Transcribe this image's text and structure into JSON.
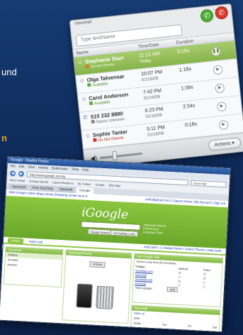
{
  "slide": {
    "fragment_1": "und",
    "fragment_2": "n",
    "fragment_3": "n,"
  },
  "callwin": {
    "title": "Voicehall",
    "search_placeholder": "Type text/Name",
    "columns": {
      "name": "Name",
      "time": "Time/Date",
      "duration": "Duration"
    },
    "rows": [
      {
        "name": "Stephanie Starr",
        "status": "On the Phone",
        "time": "11:21 AM",
        "date": "Today",
        "duration": "0:16s",
        "status_type": "phone"
      },
      {
        "name": "Olga Talvensar",
        "status": "Available",
        "time": "10:07 PM",
        "date": "01/16/08",
        "duration": "1:18s",
        "status_type": "available"
      },
      {
        "name": "Carol Anderson",
        "status": "Available",
        "time": "7:42 PM",
        "date": "01/16/08",
        "duration": "1:39s",
        "status_type": "available"
      },
      {
        "name": "510 232 8880",
        "status": "Status Unknown",
        "time": "6:23 PM",
        "date": "01/16/08",
        "duration": "2:34s",
        "status_type": "unknown"
      },
      {
        "name": "Sophie Tanter",
        "status": "Do Not Disturb",
        "time": "5:11 PM",
        "date": "01/16/08",
        "duration": "0:18s",
        "status_type": "dnd"
      }
    ],
    "actions_label": "Actions ▾"
  },
  "browser": {
    "window_title": "iGoogle - Mozilla Firefox",
    "menu": [
      "File",
      "Edit",
      "View",
      "History",
      "Bookmarks",
      "Tools",
      "Help"
    ],
    "url": "http://www.google.com/ig",
    "search_placeholder": "VoiceHall",
    "bookmarks": [
      "Most Visited",
      "Getting Started",
      "Latest Headlines",
      "My Yahoo!",
      "Google",
      "Web Mail"
    ],
    "tabs": [
      "VoiceHall",
      "Free Trial Reg",
      "Voicehall",
      "iGoogle"
    ],
    "active_tab": 3,
    "top_links": "Web Images Video Maps News Shopping Gmail more ▾",
    "account_links": "sinfo@gmail.com | Classic Home | My Account | Sign out",
    "logo": "iGoogle",
    "search_btn": "Google Search",
    "lucky_btn": "I'm Feeling Lucky",
    "side_links": [
      "Advanced Search",
      "Preferences",
      "Language Tools"
    ],
    "page_tabs": [
      "Home",
      "Add a tab"
    ],
    "right_links": "Add stuff » | Change theme | Select Theme | Hide tools",
    "gadget1_title": "VoiceHall",
    "gadget1_items": [
      "Andrew",
      "Amanda",
      "Another"
    ],
    "gadget2_title": "VoiceHall Phone",
    "gadget2_btn": "Unblock",
    "gadget3_title": "Get Google Talk",
    "gadget3_note": "Select a day from the list below...",
    "gadget3_headers": [
      "Gadget",
      "Default",
      "Feed"
    ],
    "gadget3_rows": [
      "Voicehall.com",
      "Voicehall",
      "Voicehall.com",
      "Voicehall"
    ],
    "gadget3_add_label": "Add a gadget",
    "gadget3_add_btn": "Add",
    "gadget4_title": "VoiceHall",
    "gadget4_lines": [
      "Hello, sir",
      "hello"
    ],
    "gadget4_days": [
      "Today",
      "Tue",
      "Fri",
      "Sat"
    ]
  }
}
